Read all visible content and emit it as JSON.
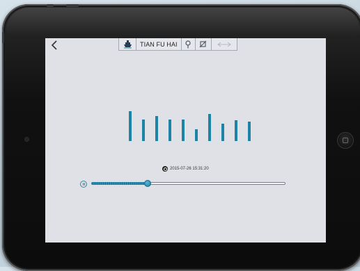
{
  "app": {
    "title": "TIAN FU HAI",
    "timestamp": "2015-07-26 15:31:20",
    "accent_color": "#1d84a6"
  },
  "toolbar": {
    "items": [
      {
        "icon": "ship-icon"
      },
      {
        "label": "TIAN FU HAI"
      },
      {
        "icon": "pin-icon"
      },
      {
        "icon": "no-signal-icon"
      },
      {
        "icon": "arrows-icon"
      }
    ]
  },
  "playback": {
    "state": "paused",
    "progress": 0.29
  },
  "bars": {
    "values": [
      0.85,
      0.62,
      0.72,
      0.62,
      0.62,
      0.33,
      0.77,
      0.5,
      0.6,
      0.56
    ]
  }
}
